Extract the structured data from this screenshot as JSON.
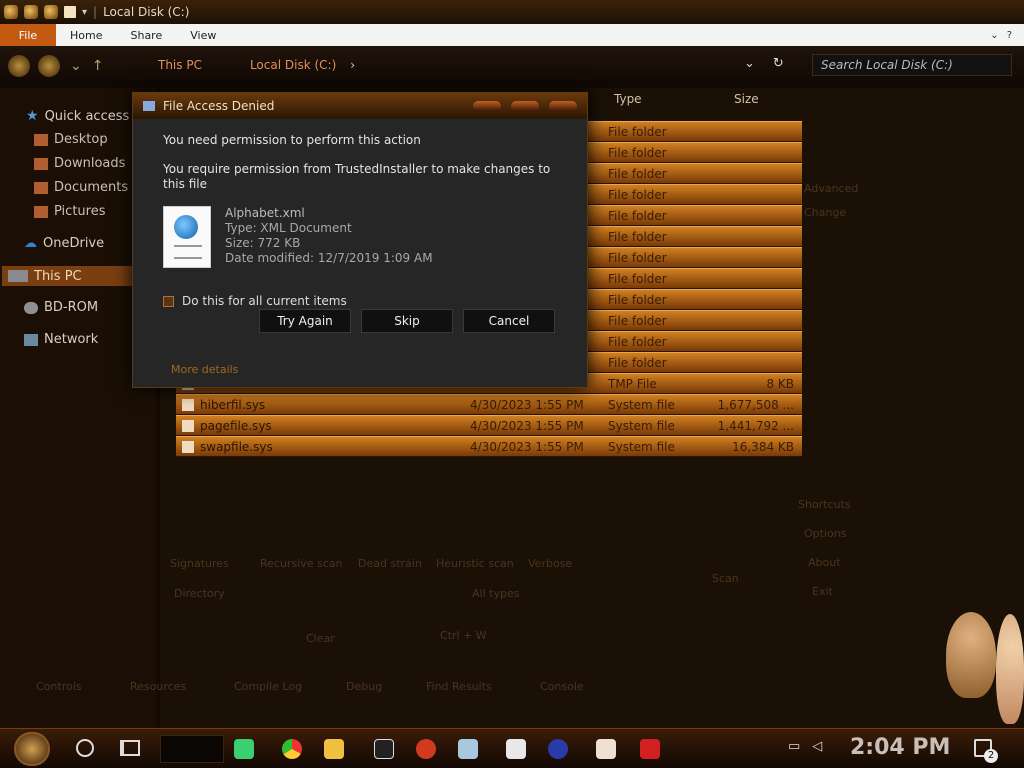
{
  "window": {
    "title": "Local Disk (C:)"
  },
  "ribbon": {
    "file": "File",
    "tabs": [
      "Home",
      "Share",
      "View"
    ]
  },
  "address": {
    "crumbs": [
      "This PC",
      "Local Disk (C:)"
    ],
    "search_placeholder": "Search Local Disk (C:)"
  },
  "sidebar": {
    "items": [
      {
        "label": "Quick access",
        "icon": "star-icon"
      },
      {
        "label": "Desktop",
        "icon": "folder-icon"
      },
      {
        "label": "Downloads",
        "icon": "folder-icon"
      },
      {
        "label": "Documents",
        "icon": "folder-icon"
      },
      {
        "label": "Pictures",
        "icon": "folder-icon"
      },
      {
        "label": "OneDrive",
        "icon": "cloud-icon"
      },
      {
        "label": "This PC",
        "icon": "pc-icon"
      },
      {
        "label": "BD-ROM",
        "icon": "disc-icon"
      },
      {
        "label": "Network",
        "icon": "network-icon"
      }
    ]
  },
  "columns": {
    "type": "Type",
    "size": "Size"
  },
  "files": [
    {
      "name": "",
      "date": "",
      "type": "File folder",
      "size": ""
    },
    {
      "name": "",
      "date": "",
      "type": "File folder",
      "size": ""
    },
    {
      "name": "",
      "date": "",
      "type": "File folder",
      "size": ""
    },
    {
      "name": "",
      "date": "",
      "type": "File folder",
      "size": ""
    },
    {
      "name": "",
      "date": "",
      "type": "File folder",
      "size": ""
    },
    {
      "name": "",
      "date": "",
      "type": "File folder",
      "size": ""
    },
    {
      "name": "",
      "date": "",
      "type": "File folder",
      "size": ""
    },
    {
      "name": "",
      "date": "",
      "type": "File folder",
      "size": ""
    },
    {
      "name": "",
      "date": "",
      "type": "File folder",
      "size": ""
    },
    {
      "name": "",
      "date": "",
      "type": "File folder",
      "size": ""
    },
    {
      "name": "",
      "date": "",
      "type": "File folder",
      "size": ""
    },
    {
      "name": "",
      "date": "",
      "type": "File folder",
      "size": ""
    },
    {
      "name": "",
      "date": "",
      "type": "TMP File",
      "size": "8 KB"
    },
    {
      "name": "hiberfil.sys",
      "date": "4/30/2023 1:55 PM",
      "type": "System file",
      "size": "1,677,508 ..."
    },
    {
      "name": "pagefile.sys",
      "date": "4/30/2023 1:55 PM",
      "type": "System file",
      "size": "1,441,792 ..."
    },
    {
      "name": "swapfile.sys",
      "date": "4/30/2023 1:55 PM",
      "type": "System file",
      "size": "16,384 KB"
    }
  ],
  "dialog": {
    "title": "File Access Denied",
    "heading": "You need permission to perform this action",
    "message": "You require permission from TrustedInstaller to make changes to this file",
    "file": {
      "name": "Alphabet.xml",
      "type": "Type: XML Document",
      "size": "Size: 772 KB",
      "modified": "Date modified: 12/7/2019 1:09 AM"
    },
    "checkbox": "Do this for all current items",
    "buttons": {
      "try_again": "Try Again",
      "skip": "Skip",
      "cancel": "Cancel"
    },
    "more": "More details"
  },
  "ghost": {
    "advanced": "Advanced",
    "change": "Change",
    "signatures": "Signatures",
    "recursive": "Recursive scan",
    "deadstrain": "Dead strain",
    "heuristic": "Heuristic scan",
    "verbose": "Verbose",
    "directory": "Directory",
    "alltypes": "All types",
    "clear": "Clear",
    "ctrlw": "Ctrl + W",
    "scan": "Scan",
    "shortcuts": "Shortcuts",
    "options": "Options",
    "about": "About",
    "exit": "Exit",
    "controls": "Controls",
    "resources": "Resources",
    "compile_log": "Compile Log",
    "debug": "Debug",
    "find_results": "Find Results",
    "console": "Console"
  },
  "taskbar": {
    "time": "2:04 PM",
    "notifications": "2"
  },
  "colors": {
    "accent": "#c25a12",
    "row": "#d08020",
    "dialog": "#262626"
  }
}
